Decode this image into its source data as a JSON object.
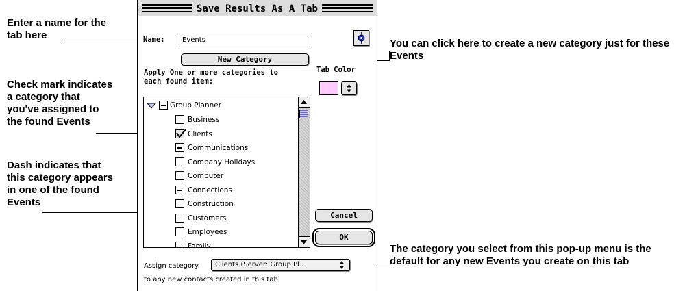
{
  "callouts": {
    "name_field": "Enter a name for the\ntab here",
    "new_category": "You can click here to create a new category just for these\nEvents",
    "check_mark": "Check mark indicates\na category that\nyou've assigned to\nthe found Events",
    "dash": "Dash indicates that\nthis category appears\nin one of the found\nEvents",
    "assign_popup": "The category you select from this pop-up menu is the\ndefault for any new Events you create on this tab"
  },
  "dialog": {
    "title": "Save Results As A Tab",
    "name_label": "Name:",
    "name_value": "Events",
    "new_category_label": "New Category",
    "apply_label": "Apply One or more categories to\neach found item:",
    "tab_color_label": "Tab Color",
    "tab_color": "#ffccff",
    "categories": {
      "parent": {
        "label": "Group Planner",
        "state": "dash",
        "expanded": true
      },
      "items": [
        {
          "label": "Business",
          "state": "empty"
        },
        {
          "label": "Clients",
          "state": "checked"
        },
        {
          "label": "Communications",
          "state": "dash"
        },
        {
          "label": "Company Holidays",
          "state": "empty"
        },
        {
          "label": "Computer",
          "state": "empty"
        },
        {
          "label": "Connections",
          "state": "dash"
        },
        {
          "label": "Construction",
          "state": "empty"
        },
        {
          "label": "Customers",
          "state": "empty"
        },
        {
          "label": "Employees",
          "state": "empty"
        },
        {
          "label": "Family",
          "state": "empty"
        }
      ]
    },
    "cancel_label": "Cancel",
    "ok_label": "OK",
    "assign_label": "Assign category",
    "assign_value": "Clients (Server: Group Pl...",
    "assign_footer": "to any new contacts created in this tab."
  },
  "icons": {
    "locator": "crosshair-icon",
    "disclosure": "triangle-down-icon",
    "popup_arrows": "up-down-arrows-icon",
    "scroll_up": "arrow-up-icon",
    "scroll_down": "arrow-down-icon"
  }
}
